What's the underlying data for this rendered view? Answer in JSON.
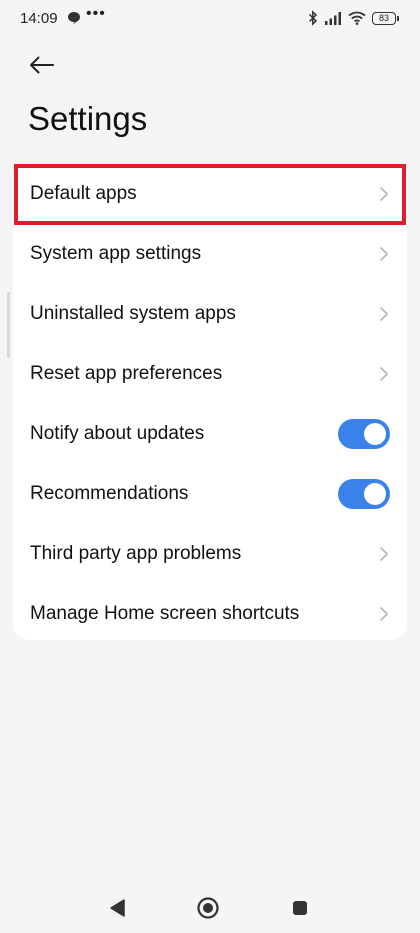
{
  "status_bar": {
    "time": "14:09",
    "dots": "•••",
    "battery": "83"
  },
  "header": {
    "title": "Settings"
  },
  "settings_list": [
    {
      "label": "Default apps",
      "control": "chevron"
    },
    {
      "label": "System app settings",
      "control": "chevron"
    },
    {
      "label": "Uninstalled system apps",
      "control": "chevron"
    },
    {
      "label": "Reset app preferences",
      "control": "chevron"
    },
    {
      "label": "Notify about updates",
      "control": "toggle",
      "on": true
    },
    {
      "label": "Recommendations",
      "control": "toggle",
      "on": true
    },
    {
      "label": "Third party app problems",
      "control": "chevron"
    },
    {
      "label": "Manage Home screen shortcuts",
      "control": "chevron"
    }
  ],
  "highlighted_item": "Default apps",
  "colors": {
    "accent": "#3b82e8",
    "highlight": "#d9202e",
    "background": "#f5f5f5",
    "card": "#ffffff"
  },
  "icons": {
    "back": "arrow-left-icon",
    "chevron": "chevron-right-icon",
    "bluetooth": "bluetooth-icon",
    "signal": "signal-icon",
    "wifi": "wifi-icon",
    "battery": "battery-icon",
    "chat": "chat-bubble-icon",
    "nav_back": "triangle-back-icon",
    "nav_home": "circle-home-icon",
    "nav_recents": "square-recents-icon"
  }
}
